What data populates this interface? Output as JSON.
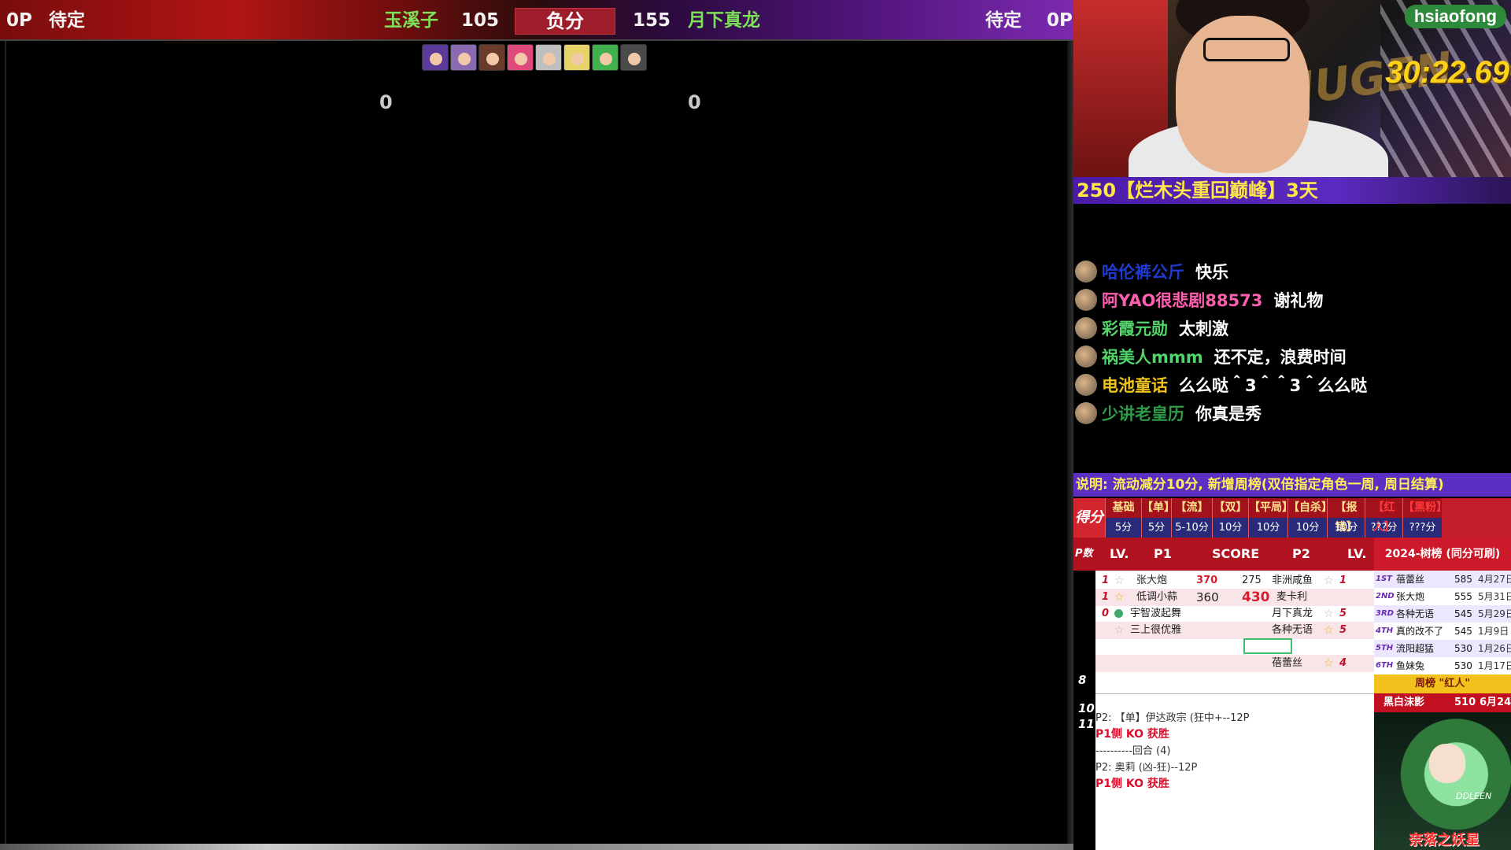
{
  "topbar": {
    "left_op": "0P",
    "left_status": "待定",
    "p1_name": "玉溪子",
    "p1_score": "105",
    "center_label": "负分",
    "p2_score": "155",
    "p2_name": "月下真龙",
    "right_status": "待定",
    "right_op": "0P"
  },
  "game": {
    "score_left": "0",
    "score_right": "0",
    "portrait_colors": [
      "#5b3a9a",
      "#8a6ab0",
      "#6a3b2b",
      "#e04a7a",
      "#bfbfbf",
      "#e6d36a",
      "#3fb24e",
      "#4a4a4a"
    ]
  },
  "stream": {
    "streamer": "hsiaofong",
    "timer": "30:22.69",
    "gift_banner": "250【烂木头重回巅峰】3天"
  },
  "chat": [
    {
      "user": "哈伦裤公斤",
      "msg": "快乐",
      "color": "#1f3ad0"
    },
    {
      "user": "阿YAO很悲剧88573",
      "msg": "谢礼物",
      "color": "#ff5fb0"
    },
    {
      "user": "彩霞元勋",
      "msg": "太刺激",
      "color": "#52d46a"
    },
    {
      "user": "祸美人mmm",
      "msg": "还不定，浪费时间",
      "color": "#52d46a"
    },
    {
      "user": "电池童话",
      "msg": "么么哒＾3＾＾3＾么么哒",
      "color": "#f0c419"
    },
    {
      "user": "少讲老皇历",
      "msg": "你真是秀",
      "color": "#2f9c4a"
    }
  ],
  "notice": "说明: 流动减分10分, 新增周榜(双倍指定角色一周, 周日结算)",
  "rules": {
    "label": "得分",
    "items": [
      {
        "name": "基础",
        "value": "5分"
      },
      {
        "name": "【单】",
        "value": "5分"
      },
      {
        "name": "【流】",
        "value": "5-10分"
      },
      {
        "name": "【双】",
        "value": "10分"
      },
      {
        "name": "【平局】",
        "value": "10分"
      },
      {
        "name": "【自杀】",
        "value": "10分"
      },
      {
        "name": "【报错】",
        "value": "10分"
      },
      {
        "name": "【红人】",
        "value": "???分"
      },
      {
        "name": "【黑粉】",
        "value": "???分"
      }
    ]
  },
  "match_table": {
    "head_idx": "P数",
    "head_lv": "LV.",
    "head_p1": "P1",
    "head_score": "SCORE",
    "head_p2": "P2",
    "head_lv2": "LV.",
    "idx_labels": [
      "8",
      "10",
      "11"
    ],
    "rows": [
      {
        "lv1": "1",
        "p1": "张大炮",
        "s1": "370",
        "s2": "275",
        "p2": "非洲咸鱼",
        "lv2": "1"
      },
      {
        "lv1": "1",
        "p1": "低调小蒜",
        "s1": "360",
        "s2": "430",
        "p2": "麦卡利",
        "lv2": ""
      },
      {
        "lv1": "0",
        "p1": "宇智波起舞",
        "s1": "",
        "s2": "",
        "p2": "月下真龙",
        "lv2": "5"
      },
      {
        "lv1": "",
        "p1": "三上很优雅",
        "s1": "",
        "s2": "",
        "p2": "各种无语",
        "lv2": "5"
      },
      {
        "lv1": "",
        "p1": "",
        "s1": "",
        "s2": "",
        "p2": "",
        "lv2": ""
      },
      {
        "lv1": "",
        "p1": "",
        "s1": "",
        "s2": "",
        "p2": "蓓蕾丝",
        "lv2": "4"
      }
    ],
    "logs": [
      {
        "text": "P2: 【单】伊达政宗 (狂中+--12P",
        "red": false
      },
      {
        "text": "P1侧 KO 获胜",
        "red": true
      },
      {
        "text": "----------回合 (4)",
        "red": false
      },
      {
        "text": "P2: 奥莉 (凶-狂)--12P",
        "red": false
      },
      {
        "text": "P1侧 KO 获胜",
        "red": true
      }
    ]
  },
  "leaderboard": {
    "title": "2024-树榜 (同分可刷)",
    "entries": [
      {
        "rank": "1ST",
        "name": "蓓蕾丝",
        "score": "585",
        "date": "4月27日"
      },
      {
        "rank": "2ND",
        "name": "张大炮",
        "score": "555",
        "date": "5月31日"
      },
      {
        "rank": "3RD",
        "name": "各种无语",
        "score": "545",
        "date": "5月29日"
      },
      {
        "rank": "4TH",
        "name": "真的改不了",
        "score": "545",
        "date": "1月9日"
      },
      {
        "rank": "5TH",
        "name": "流阳超猛",
        "score": "530",
        "date": "1月26日"
      },
      {
        "rank": "6TH",
        "name": "鱼妹兔",
        "score": "530",
        "date": "1月17日"
      }
    ],
    "weekly_label": "周榜 \"红人\"",
    "weekly_name": "黑白沫影",
    "weekly_score": "510",
    "weekly_date": "6月24日",
    "char_label": "奈落之妖星",
    "char_sig": "DDLEEN"
  }
}
